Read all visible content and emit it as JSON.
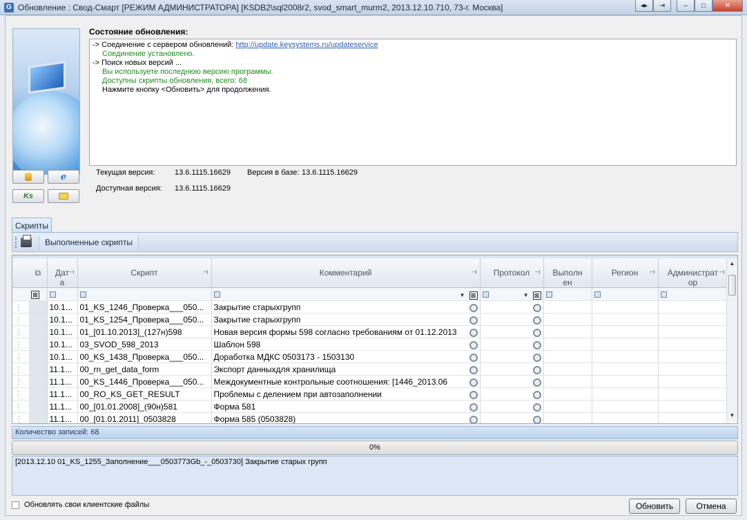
{
  "window": {
    "title": "Обновление : Свод-Смарт [РЕЖИМ АДМИНИСТРАТОРА] [KSDB2\\sql2008r2, svod_smart_murm2, 2013.12.10.710, 73-г. Москва]",
    "app_icon_glyph": "G",
    "buttons": [
      "◂▸",
      "⇥",
      "–",
      "□",
      "✕"
    ]
  },
  "side_buttons": {
    "icons": [
      "database-icon",
      "internet-explorer-icon",
      "ks-logo-icon",
      "folder-icon"
    ],
    "ie_glyph": "e",
    "ks_glyph": "Ks"
  },
  "status": {
    "heading": "Состояние обновления:",
    "lines": [
      {
        "prefix": "-> Соединение с сервером обновлений: ",
        "link": "http://update.keysystems.ru/updateservice"
      },
      {
        "text": "Соединение установлено.",
        "color": "#1e8c1e"
      },
      {
        "text": "-> Поиск новых версий ..."
      },
      {
        "text": "Вы используете последнюю версию программы.",
        "color": "#1e8c1e"
      },
      {
        "text": "Доступны скрипты обновления, всего: 68",
        "color": "#1e8c1e"
      },
      {
        "text": "Нажмите кнопку <Обновить> для продолжения."
      }
    ]
  },
  "versions": {
    "current_label": "Текущая версия:",
    "current_value": "13.6.1115.16629",
    "db_label": "Версия в базе:",
    "db_value": "13.6.1115.16629",
    "available_label": "Доступная версия:",
    "available_value": "13.6.1115.16629"
  },
  "tabs": {
    "active": "Скрипты"
  },
  "toolbar": {
    "executed_label": "Выполненные скрипты"
  },
  "grid": {
    "columns": [
      "Дата",
      "Скрипт",
      "Комментарий",
      "Протокол",
      "Выполнен",
      "Регион",
      "Администратор"
    ],
    "column_display": [
      "Дат\nа",
      "Скрипт",
      "Комментарий",
      "Протокол",
      "Выполн\nен",
      "Регион",
      "Администрат\nор"
    ],
    "rows": [
      {
        "date": "10.1...",
        "script": "01_KS_1246_Проверка___050...",
        "comment": "Закрытие старыхгрупп"
      },
      {
        "date": "10.1...",
        "script": "01_KS_1254_Проверка___050...",
        "comment": "Закрытие старыхгрупп"
      },
      {
        "date": "10.1...",
        "script": "01_[01.10.2013]_(127н)598",
        "comment": "Новая версия формы 598 согласно требованиям от 01.12.2013"
      },
      {
        "date": "10.1...",
        "script": "03_SVOD_598_2013",
        "comment": "Шаблон 598"
      },
      {
        "date": "10.1...",
        "script": "00_KS_1438_Проверка___050...",
        "comment": "Доработка МДКС 0503173 - 1503130"
      },
      {
        "date": "11.1...",
        "script": "00_rn_get_data_form",
        "comment": "Экспорт данныхдля хранилища"
      },
      {
        "date": "11.1...",
        "script": "00_KS_1446_Проверка___050...",
        "comment": "Междокументные контрольные соотношения: [1446_2013.06"
      },
      {
        "date": "11.1...",
        "script": "00_RO_KS_GET_RESULT",
        "comment": "Проблемы с делением при автозаполнении"
      },
      {
        "date": "11.1...",
        "script": "00_[01.01.2008]_(90н)581",
        "comment": "Форма 581"
      },
      {
        "date": "11.1...",
        "script": "00_[01.01.2011]_0503828",
        "comment": "Форма 585 (0503828)"
      }
    ]
  },
  "count_label": "Количество записей: 68",
  "progress": {
    "percent": 0,
    "label": "0%"
  },
  "progress_log": "[2013.12.10  01_KS_1255_Заполнение___0503773Gb_-_0503730]  Закрытие  старых  групп",
  "footer": {
    "checkbox_label": "Обновлять свои клиентские файлы",
    "checkbox_checked": false,
    "update_button": "Обновить",
    "cancel_button": "Отмена"
  }
}
